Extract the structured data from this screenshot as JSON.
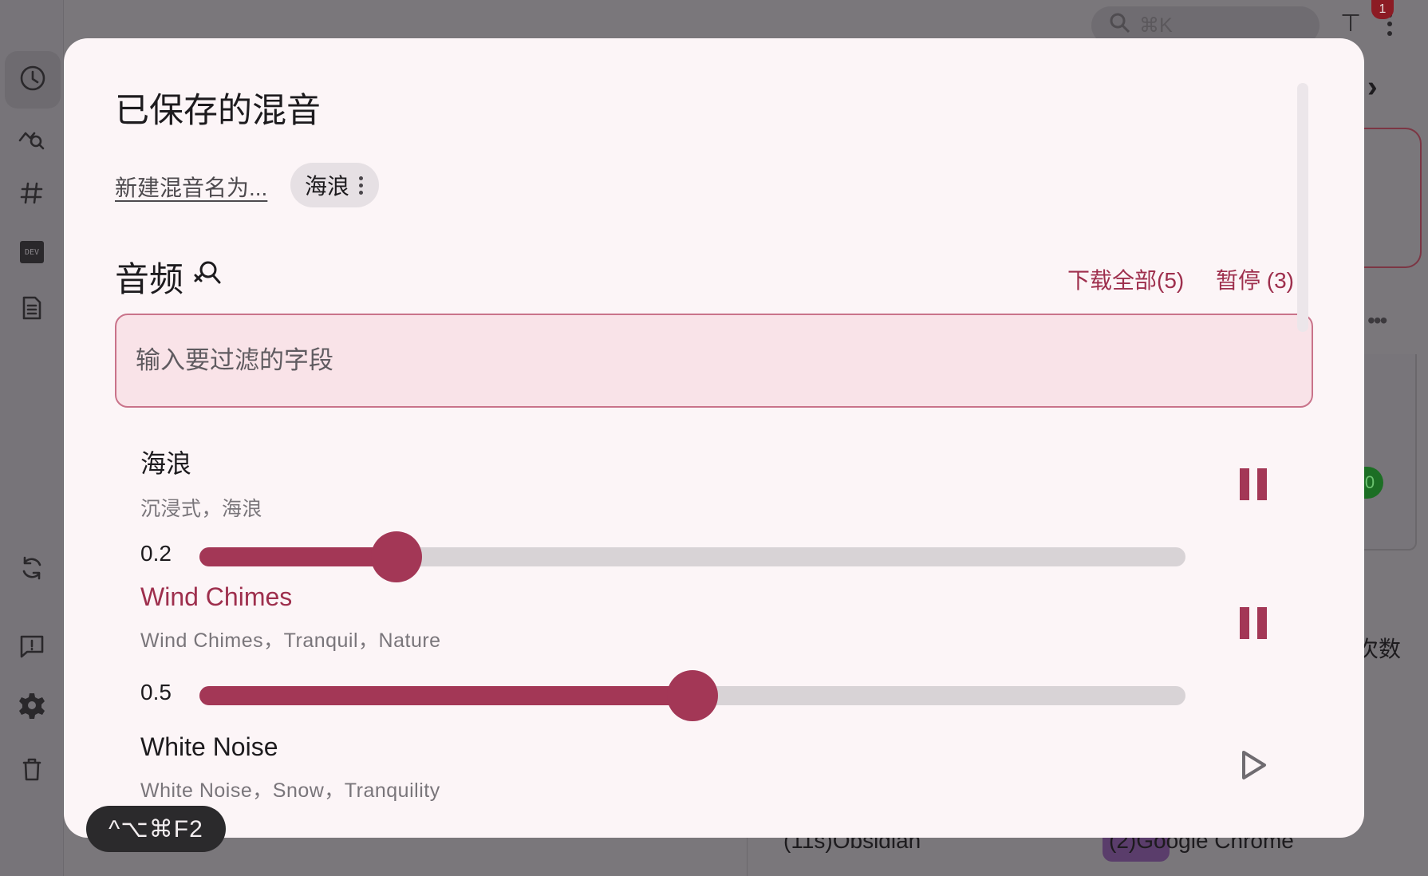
{
  "background": {
    "search_placeholder": "⌘K",
    "notification_count": "1",
    "count_label_fragment": "次数",
    "green_badge_fragment": "0",
    "bottom_item_1": "(11s)Obsidian",
    "bottom_item_2": "(2)Google Chrome"
  },
  "dialog": {
    "title": "已保存的混音",
    "new_mix_link": "新建混音名为...",
    "saved_mix_chip": "海浪",
    "section_title": "音频",
    "download_all": "下载全部(5)",
    "pause_all": "暂停 (3)",
    "filter_placeholder": "输入要过滤的字段",
    "sounds": [
      {
        "name": "海浪",
        "tags": "沉浸式，海浪",
        "volume_label": "0.2",
        "volume": 0.2,
        "playing": true,
        "highlighted": false
      },
      {
        "name": "Wind Chimes",
        "tags": "Wind Chimes，Tranquil，Nature",
        "volume_label": "0.5",
        "volume": 0.5,
        "playing": true,
        "highlighted": true
      },
      {
        "name": "White Noise",
        "tags": "White Noise，Snow，Tranquility",
        "playing": false,
        "highlighted": false
      }
    ]
  },
  "keyboard_hint": "^⌥⌘F2",
  "colors": {
    "accent": "#a33756",
    "accent_text": "#9e2f4d",
    "dialog_bg": "#fcf5f7",
    "filter_bg": "#f9e3e8",
    "overlay": "#7a777b"
  }
}
